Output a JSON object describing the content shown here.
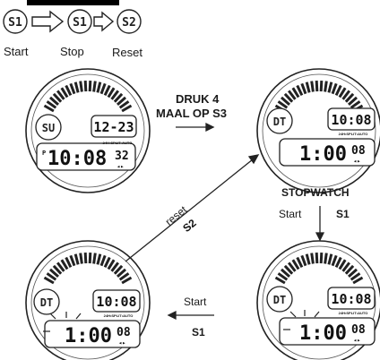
{
  "sequence": {
    "buttons": [
      "S1",
      "S1",
      "S2"
    ],
    "labels": [
      "Start",
      "Stop",
      "Reset"
    ]
  },
  "watch_top_left": {
    "badge": "SU",
    "top_time": "12-23",
    "small_caption": "24H•SPLIT•AUTO",
    "bottom_prefix": "P",
    "bottom_time": "10:08",
    "bottom_sec": "32"
  },
  "watch_top_right": {
    "badge": "DT",
    "top_time": "10:08",
    "small_caption": "24H•SPLIT•AUTO",
    "bottom_time": "1:00",
    "bottom_sec": "08"
  },
  "watch_bottom_left": {
    "badge": "DT",
    "top_time": "10:08",
    "small_caption": "24H•SPLIT•AUTO",
    "bottom_time": "1:00",
    "bottom_sec": "08"
  },
  "watch_bottom_right": {
    "badge": "DT",
    "top_time": "10:08",
    "small_caption": "24H•SPLIT•AUTO",
    "bottom_time": "1:00",
    "bottom_sec": "08"
  },
  "instructions": {
    "press_line1": "DRUK 4",
    "press_line2": "MAAL OP S3",
    "stopwatch": "STOPWATCH",
    "start_down": "Start",
    "start_down_btn": "S1",
    "reset_word": "reset",
    "reset_btn": "S2",
    "start_left": "Start",
    "start_left_btn": "S1"
  }
}
